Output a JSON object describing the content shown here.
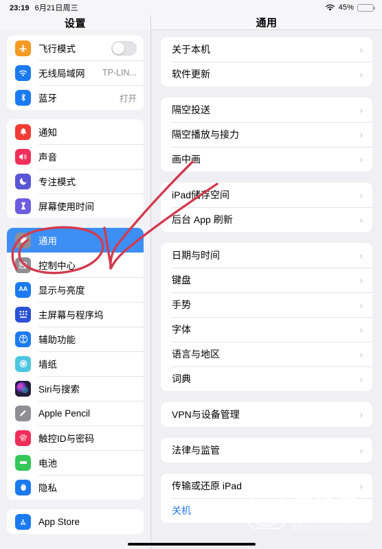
{
  "status_bar": {
    "time": "23:19",
    "date": "6月21日周三",
    "battery_percent": "45%",
    "battery_level": 45,
    "battery_color": "#f6c915",
    "wifi_icon": "wifi-icon"
  },
  "left_pane": {
    "title": "设置",
    "groups": [
      {
        "rows": [
          {
            "label": "飞行模式",
            "icon": "airplane-icon",
            "icon_color": "#f59a23",
            "control": "toggle",
            "toggle_on": false
          },
          {
            "label": "无线局域网",
            "icon": "wifi-icon",
            "icon_color": "#1c7af0",
            "value": "TP-LIN..."
          },
          {
            "label": "蓝牙",
            "icon": "bluetooth-icon",
            "icon_color": "#1c7af0",
            "value": "打开"
          }
        ]
      },
      {
        "rows": [
          {
            "label": "通知",
            "icon": "bell-icon",
            "icon_color": "#f13b34"
          },
          {
            "label": "声音",
            "icon": "speaker-icon",
            "icon_color": "#ef2f5a"
          },
          {
            "label": "专注模式",
            "icon": "moon-icon",
            "icon_color": "#5a56d6"
          },
          {
            "label": "屏幕使用时间",
            "icon": "hourglass-icon",
            "icon_color": "#6b5ce0"
          }
        ]
      },
      {
        "rows": [
          {
            "label": "通用",
            "icon": "gear-icon",
            "icon_color": "#8e8e93",
            "selected": true
          },
          {
            "label": "控制中心",
            "icon": "sliders-icon",
            "icon_color": "#8e8e93"
          },
          {
            "label": "显示与亮度",
            "icon": "text-size-icon",
            "icon_color": "#1c7af0"
          },
          {
            "label": "主屏幕与程序坞",
            "icon": "home-grid-icon",
            "icon_color": "#2a51d6"
          },
          {
            "label": "辅助功能",
            "icon": "accessibility-icon",
            "icon_color": "#1c7af0"
          },
          {
            "label": "墙纸",
            "icon": "wallpaper-icon",
            "icon_color": "#4cc6e0"
          },
          {
            "label": "Siri与搜索",
            "icon": "siri-icon",
            "icon_color": "#2b2040"
          },
          {
            "label": "Apple Pencil",
            "icon": "pencil-icon",
            "icon_color": "#8e8e93"
          },
          {
            "label": "触控ID与密码",
            "icon": "fingerprint-icon",
            "icon_color": "#ef2f5a"
          },
          {
            "label": "电池",
            "icon": "battery-icon",
            "icon_color": "#34c759"
          },
          {
            "label": "隐私",
            "icon": "hand-icon",
            "icon_color": "#1c7af0"
          }
        ]
      },
      {
        "rows": [
          {
            "label": "App Store",
            "icon": "appstore-icon",
            "icon_color": "#1c7af0"
          }
        ]
      }
    ]
  },
  "right_pane": {
    "title": "通用",
    "groups": [
      {
        "rows": [
          {
            "label": "关于本机",
            "chevron": "›"
          },
          {
            "label": "软件更新",
            "chevron": "›"
          }
        ]
      },
      {
        "rows": [
          {
            "label": "隔空投送",
            "chevron": "›"
          },
          {
            "label": "隔空播放与接力",
            "chevron": "›"
          },
          {
            "label": "画中画",
            "chevron": "›"
          }
        ]
      },
      {
        "rows": [
          {
            "label": "iPad储存空间",
            "chevron": "›"
          },
          {
            "label": "后台 App 刷新",
            "chevron": "›"
          }
        ]
      },
      {
        "rows": [
          {
            "label": "日期与时间",
            "chevron": "›"
          },
          {
            "label": "键盘",
            "chevron": "›"
          },
          {
            "label": "手势",
            "chevron": "›"
          },
          {
            "label": "字体",
            "chevron": "›"
          },
          {
            "label": "语言与地区",
            "chevron": "›"
          },
          {
            "label": "词典",
            "chevron": "›"
          }
        ]
      },
      {
        "rows": [
          {
            "label": "VPN与设备管理",
            "chevron": "›"
          }
        ]
      },
      {
        "rows": [
          {
            "label": "法律与监管",
            "chevron": "›"
          }
        ]
      },
      {
        "rows": [
          {
            "label": "传输或还原 iPad",
            "chevron": "›"
          },
          {
            "label": "关机",
            "accent": true
          }
        ]
      }
    ]
  },
  "annotation": {
    "color": "#d23b4e",
    "shapes": [
      "circle-around-general-row",
      "curved-arrow-to-general-row"
    ]
  },
  "watermark": {
    "brand": "手机鼠",
    "domain": "SHOUJISHU.COM"
  }
}
